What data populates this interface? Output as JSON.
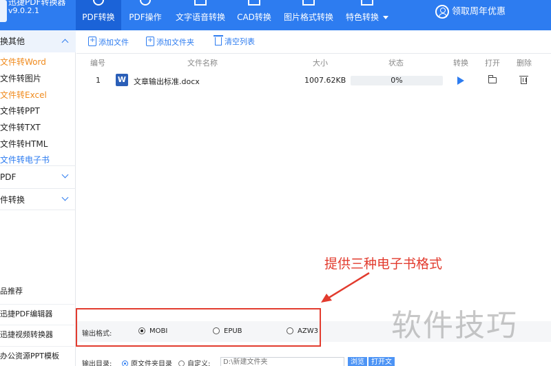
{
  "app": {
    "name": "迅捷PDF转换器",
    "version": "v9.0.2.1"
  },
  "nav": {
    "tabs": [
      {
        "label": "PDF转换"
      },
      {
        "label": "PDF操作"
      },
      {
        "label": "文字语音转换"
      },
      {
        "label": "CAD转换"
      },
      {
        "label": "图片格式转换"
      },
      {
        "label": "特色转换"
      }
    ],
    "promo": "领取周年优惠"
  },
  "sidebar": {
    "group_other": "换其他",
    "items": [
      {
        "label": "文件转Word"
      },
      {
        "label": "文件转图片"
      },
      {
        "label": "文件转Excel"
      },
      {
        "label": "文件转PPT"
      },
      {
        "label": "文件转TXT"
      },
      {
        "label": "文件转HTML"
      },
      {
        "label": "文件转电子书"
      }
    ],
    "group_pdf": "PDF",
    "group_file": "件转换",
    "recommend_title": "品推荐",
    "links": [
      {
        "label": "迅捷PDF编辑器"
      },
      {
        "label": "迅捷视频转换器"
      },
      {
        "label": "办公资源PPT模板"
      }
    ]
  },
  "toolbar": {
    "add_file": "添加文件",
    "add_folder": "添加文件夹",
    "clear_list": "清空列表"
  },
  "table": {
    "headers": {
      "index": "编号",
      "name": "文件名称",
      "size": "大小",
      "status": "状态",
      "convert": "转换",
      "open": "打开",
      "delete": "删除"
    },
    "rows": [
      {
        "index": "1",
        "file_type": "W",
        "name": "文章输出标准.docx",
        "size": "1007.62KB",
        "progress_text": "0%",
        "progress": 0
      }
    ]
  },
  "annotation": {
    "text": "提供三种电子书格式"
  },
  "output_format": {
    "label": "输出格式:",
    "options": [
      {
        "label": "MOBI",
        "checked": true
      },
      {
        "label": "EPUB",
        "checked": false
      },
      {
        "label": "AZW3",
        "checked": false
      }
    ]
  },
  "output_dir": {
    "label": "输出目录:",
    "option_source": "原文件夹目录",
    "option_custom": "自定义:",
    "path_placeholder": "D:\\新建文件夹",
    "browse": "浏览",
    "open_folder": "打开文"
  },
  "watermark": "软件技巧",
  "colors": {
    "brand": "#2d7cf0",
    "annotation": "#e23b2e",
    "sidebar_highlight": "#f08a1c"
  }
}
